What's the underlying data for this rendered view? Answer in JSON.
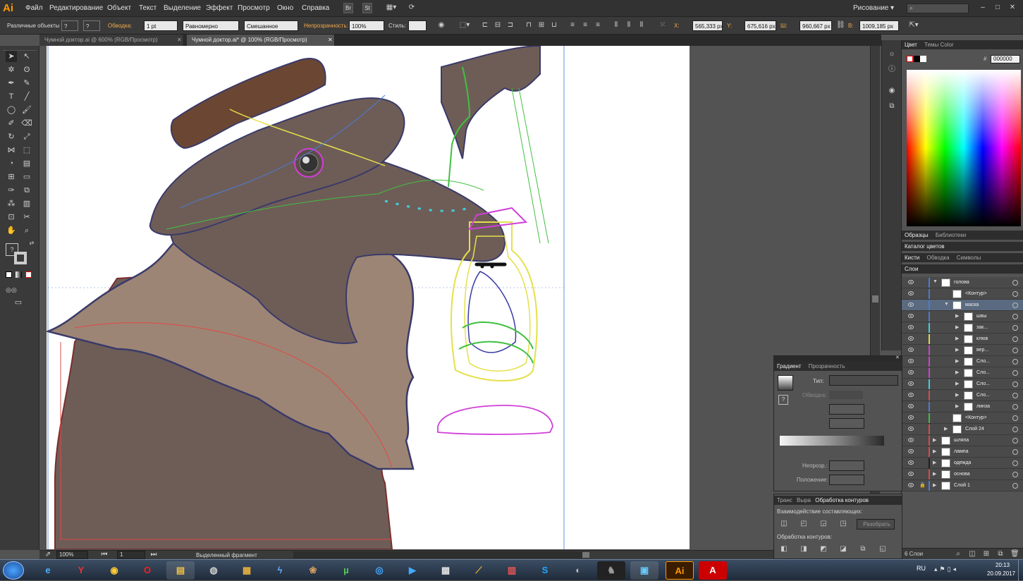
{
  "app": {
    "logo": "Ai",
    "workspace": "Рисование",
    "workspace_arrow": "▾"
  },
  "menu": [
    "Файл",
    "Редактирование",
    "Объект",
    "Текст",
    "Выделение",
    "Эффект",
    "Просмотр",
    "Окно",
    "Справка"
  ],
  "menubar_buttons": {
    "br": "Br",
    "st": "St"
  },
  "control": {
    "selection_label": "Различные объекты",
    "q1": "?",
    "q2": "?",
    "stroke_label": "Обводка:",
    "stroke_value": "1 pt",
    "profile_label": "Равномерно",
    "mix_label": "Смешанное",
    "opacity_label": "Непрозрачность:",
    "opacity_value": "100%",
    "style_label": "Стиль:",
    "x_label": "X:",
    "x_value": "565,333 px",
    "y_label": "Y:",
    "y_value": "675,616 px",
    "w_label": "Ш:",
    "w_value": "960,667 px",
    "h_label": "В:",
    "h_value": "1009,185 px"
  },
  "tabs": [
    {
      "label": "Чумной доктор.ai @ 600% (RGB/Просмотр)",
      "close": "✕",
      "active": false
    },
    {
      "label": "Чумной доктор.ai* @ 100% (RGB/Просмотр)",
      "close": "✕",
      "active": true
    }
  ],
  "status": {
    "zoom": "100%",
    "page": "1",
    "info": "Выделенный фрагмент"
  },
  "color_panel": {
    "tab1": "Цвет",
    "tab2": "Темы Color",
    "hex_label": "#",
    "hex_value": "000000"
  },
  "swatches_panel": {
    "tab1": "Образцы",
    "tab2": "Библиотеки"
  },
  "catalog_panel": {
    "title": "Каталог цветов"
  },
  "brushes_panel": {
    "tab1": "Кисти",
    "tab2": "Обводка",
    "tab3": "Символы"
  },
  "layers_panel": {
    "title": "Слои",
    "footer": "6 Слои",
    "layers": [
      {
        "name": "голова",
        "color": "#4a7bd6",
        "indent": 0,
        "expanded": true,
        "selected": false
      },
      {
        "name": "<Контур>",
        "color": "#4a7bd6",
        "indent": 1,
        "expanded": null,
        "selected": false
      },
      {
        "name": "маска",
        "color": "#4a7bd6",
        "indent": 1,
        "expanded": true,
        "selected": true
      },
      {
        "name": "швы",
        "color": "#4a7bd6",
        "indent": 2,
        "expanded": false,
        "selected": false
      },
      {
        "name": "зак...",
        "color": "#3fd0e0",
        "indent": 2,
        "expanded": false,
        "selected": false
      },
      {
        "name": "клюв",
        "color": "#e0d84a",
        "indent": 2,
        "expanded": false,
        "selected": false
      },
      {
        "name": "вер...",
        "color": "#d040d8",
        "indent": 2,
        "expanded": false,
        "selected": false
      },
      {
        "name": "Сло...",
        "color": "#d040d8",
        "indent": 2,
        "expanded": false,
        "selected": false
      },
      {
        "name": "Сло...",
        "color": "#d040d8",
        "indent": 2,
        "expanded": false,
        "selected": false
      },
      {
        "name": "Сло...",
        "color": "#3fd0e0",
        "indent": 2,
        "expanded": false,
        "selected": false
      },
      {
        "name": "Сло...",
        "color": "#e04848",
        "indent": 2,
        "expanded": false,
        "selected": false
      },
      {
        "name": "линза",
        "color": "#4a7bd6",
        "indent": 2,
        "expanded": false,
        "selected": false
      },
      {
        "name": "<Контур>",
        "color": "#40c040",
        "indent": 1,
        "expanded": null,
        "selected": false
      },
      {
        "name": "Слой 24",
        "color": "#e04848",
        "indent": 1,
        "expanded": false,
        "selected": false
      },
      {
        "name": "шляпа",
        "color": "#e04848",
        "indent": 0,
        "expanded": false,
        "selected": false
      },
      {
        "name": "лампа",
        "color": "#e04848",
        "indent": 0,
        "expanded": false,
        "selected": false
      },
      {
        "name": "одежда",
        "color": "#202020",
        "indent": 0,
        "expanded": false,
        "selected": false
      },
      {
        "name": "основа",
        "color": "#e04848",
        "indent": 0,
        "expanded": false,
        "selected": false
      },
      {
        "name": "Слой 1",
        "color": "#4a7bd6",
        "indent": 0,
        "expanded": false,
        "selected": false,
        "locked": true
      }
    ]
  },
  "gradient_panel": {
    "tab1": "Градиент",
    "tab2": "Прозрачность",
    "type_label": "Тип:",
    "stroke_label": "Обводка:",
    "opacity_label": "Непрозр.:",
    "position_label": "Положение:",
    "q": "?"
  },
  "pathfinder_panel": {
    "tab1": "Транс",
    "tab2": "Выра",
    "tab3": "Обработка контуров",
    "shape_modes": "Взаимодействие составляющих:",
    "expand_button": "Разобрать",
    "pathfinders": "Обработка контуров:"
  },
  "taskbar": {
    "lang": "RU",
    "time": "20:13",
    "date": "20.09.2017",
    "icons": [
      "start-icon",
      "ie-icon",
      "yandex-icon",
      "chrome-icon",
      "opera-icon",
      "explorer-icon",
      "nero-icon",
      "archive-icon",
      "flash-icon",
      "image-viewer-icon",
      "torrent-icon",
      "globe-icon",
      "play-icon",
      "mpc-icon",
      "tool-icon",
      "office-icon",
      "skype-icon",
      "steam-icon",
      "game-icon",
      "photos-icon",
      "illustrator-icon",
      "acrobat-icon"
    ]
  },
  "colors": {
    "accent_orange": "#f4a94a",
    "ai_brand": "#ff9a00",
    "selection_blue": "#5a6a80"
  }
}
